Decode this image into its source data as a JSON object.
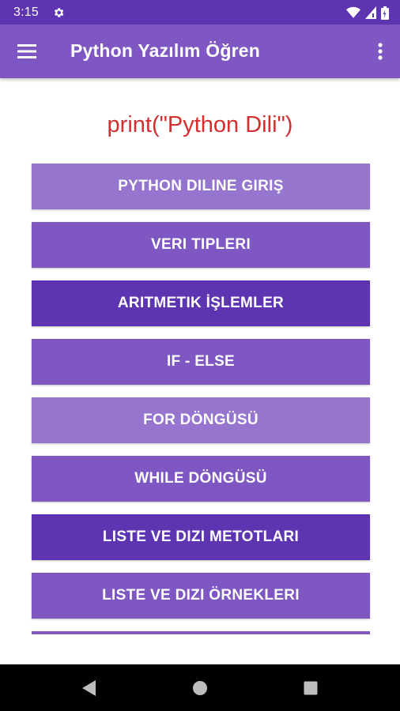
{
  "status_bar": {
    "time": "3:15",
    "icons": [
      "settings-icon",
      "wifi-icon",
      "signal-icon",
      "battery-icon"
    ]
  },
  "app_bar": {
    "title": "Python Yazılım Öğren",
    "left_icon": "menu-icon",
    "right_icon": "more-vert-icon"
  },
  "headline": "print(\"Python Dili\")",
  "buttons": [
    {
      "label": "PYTHON DILINE GIRIŞ"
    },
    {
      "label": "VERI TIPLERI"
    },
    {
      "label": "ARITMETIK İŞLEMLER"
    },
    {
      "label": "IF - ELSE"
    },
    {
      "label": "FOR DÖNGÜSÜ"
    },
    {
      "label": "WHILE DÖNGÜSÜ"
    },
    {
      "label": "LISTE VE DIZI METOTLARI"
    },
    {
      "label": "LISTE VE DIZI ÖRNEKLERI"
    }
  ],
  "colors": {
    "status_bar": "#5e35b1",
    "app_bar": "#7e57c2",
    "headline": "#d32f2f",
    "button_light": "#9575cd",
    "button_mid": "#7e57c2",
    "button_dark": "#5e35b1"
  },
  "nav_bar": {
    "icons": [
      "back-icon",
      "home-icon",
      "recents-icon"
    ]
  }
}
